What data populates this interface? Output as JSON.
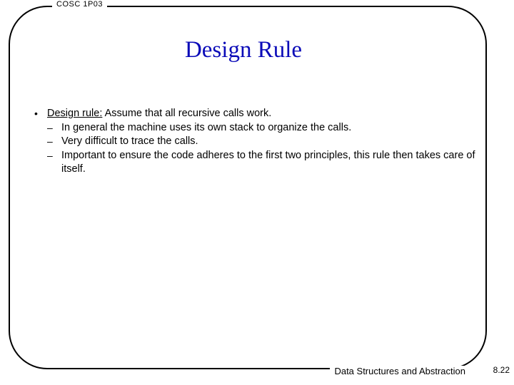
{
  "header": {
    "course": "COSC 1P03"
  },
  "title": "Design Rule",
  "bullet": {
    "lead": "Design rule:",
    "rest": " Assume that all recursive calls work.",
    "subs": [
      "In general the machine uses its own stack to organize the calls.",
      "Very difficult to trace the calls.",
      "Important to ensure the code adheres to the first two principles, this rule then takes care of itself."
    ]
  },
  "footer": {
    "course_title": "Data Structures and Abstraction",
    "page": "8.22"
  }
}
